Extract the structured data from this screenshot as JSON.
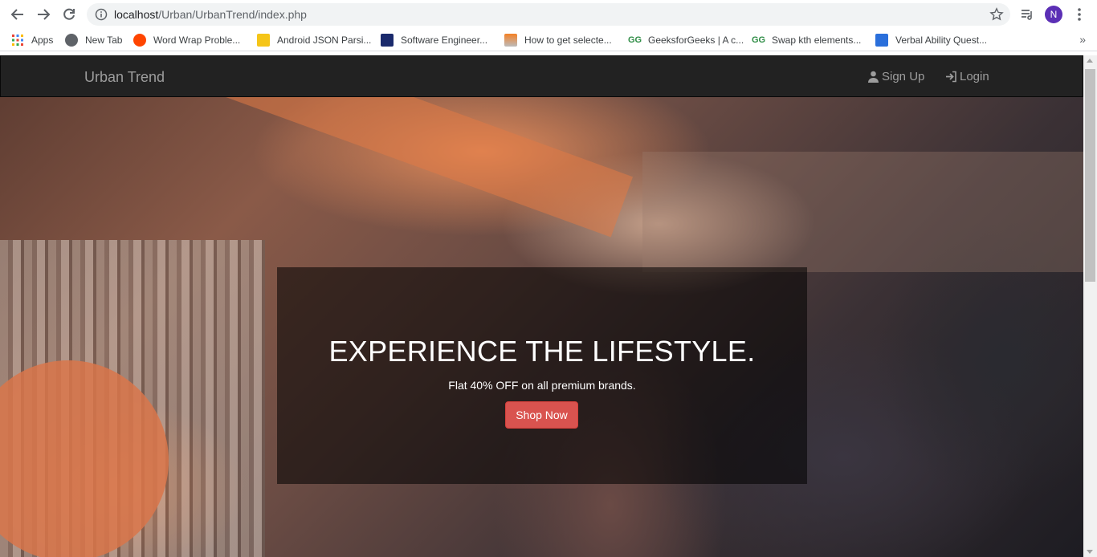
{
  "browser": {
    "url_host": "localhost",
    "url_path": "/Urban/UrbanTrend/index.php",
    "avatar_initial": "N"
  },
  "bookmarks": [
    {
      "label": "Apps",
      "icon": "apps-grid-icon"
    },
    {
      "label": "New Tab",
      "icon": "globe-icon"
    },
    {
      "label": "Word Wrap Proble...",
      "icon": "reddit-icon"
    },
    {
      "label": "Android JSON Parsi...",
      "icon": "android-json-icon"
    },
    {
      "label": "Software Engineer...",
      "icon": "p-logo-icon"
    },
    {
      "label": "How to get selecte...",
      "icon": "stackoverflow-icon"
    },
    {
      "label": "GeeksforGeeks | A c...",
      "icon": "geeksforgeeks-icon"
    },
    {
      "label": "Swap kth elements...",
      "icon": "geeksforgeeks-icon"
    },
    {
      "label": "Verbal Ability Quest...",
      "icon": "indiabix-icon"
    }
  ],
  "navbar": {
    "brand": "Urban Trend",
    "signup": "Sign Up",
    "login": "Login"
  },
  "hero": {
    "title": "EXPERIENCE THE LIFESTYLE.",
    "subtitle": "Flat 40% OFF on all premium brands.",
    "button": "Shop Now"
  },
  "colors": {
    "navbar_bg": "#222222",
    "nav_text": "#9d9d9d",
    "button_red": "#d9534f"
  }
}
